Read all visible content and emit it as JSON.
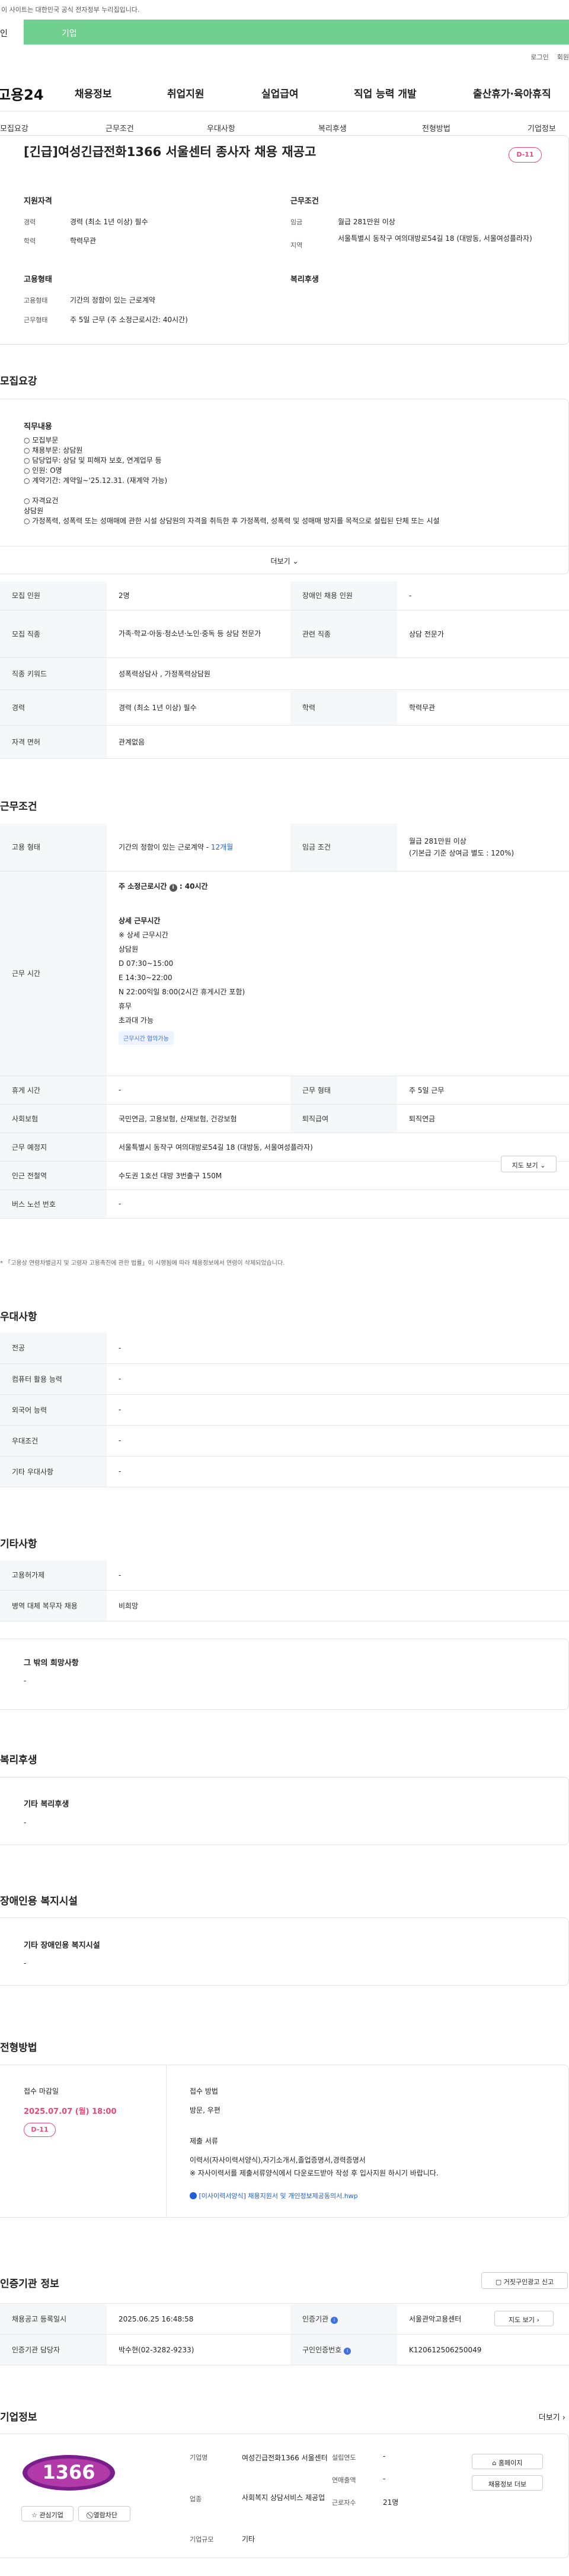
{
  "topbar": {
    "notice": "이 사이트는 대한민국 공식 전자정부 누리집입니다."
  },
  "tabs": [
    "인",
    "기업"
  ],
  "util": [
    "로그인",
    "회원"
  ],
  "gnb": {
    "logo": "고용24",
    "menus": [
      "채용정보",
      "취업지원",
      "실업급여",
      "직업 능력 개발",
      "출산휴가·육아휴직"
    ]
  },
  "subnav": [
    "모집요강",
    "근무조건",
    "우대사항",
    "복리후생",
    "전형방법",
    "기업정보"
  ],
  "job": {
    "title": "[긴급]여성긴급전화1366 서울센터 종사자 채용 재공고",
    "dday": "D-11"
  },
  "summary": {
    "apply_title": "지원자격",
    "cond_title": "근무조건",
    "emp_title": "고용형태",
    "welfare_title": "복리후생",
    "career_lbl": "경력",
    "career": "경력 (최소 1년 이상) 필수",
    "edu_lbl": "학력",
    "edu": "학력무관",
    "wage_lbl": "임금",
    "wage": "월급 281만원 이상",
    "area_lbl": "지역",
    "area": "서울특별시 동작구 여의대방로54길 18 (대방동, 서울여성플라자)",
    "type_lbl": "고용형태",
    "type": "기간의 정함이 있는 근로계약",
    "form_lbl": "근무형태",
    "form": "주 5일 근무 (주 소정근로시간: 40시간)"
  },
  "req": {
    "head": "모집요강",
    "duty_title": "직무내용",
    "duty": "○ 모집부문\n○ 채용부문: 상담원\n○ 담당업무: 상담 및 피해자 보호, 연계업무 등\n○ 인원: O명\n○ 계약기간: 계약일~'25.12.31. (재계약 가능)\n\n○ 자격요건\n상담원\n○ 가정폭력, 성폭력 또는 성매매에 관한 시설 상담원의 자격을 취득한 후 가정폭력, 성폭력 및 성매매 방지를 목적으로 설립된 단체 또는 시설",
    "more": "더보기",
    "rows": [
      [
        "모집 인원",
        "2명",
        "장애인 채용 인원",
        "-"
      ],
      [
        "모집 직종",
        "가족·학교·아동·청소년·노인·중독 등 상담 전문가",
        "관련 직종",
        "상담 전문가"
      ],
      [
        "직종 키워드",
        "성폭력상담사 , 가정폭력상담원",
        "",
        ""
      ],
      [
        "경력",
        "경력 (최소 1년 이상) 필수",
        "학력",
        "학력무관"
      ],
      [
        "자격 면허",
        "관계없음",
        "",
        ""
      ]
    ]
  },
  "cond": {
    "head": "근무조건",
    "type_lbl": "고용 형태",
    "type": "기간의 정함이 있는 근로계약 - ",
    "months": "12개월",
    "wage_lbl": "임금 조건",
    "wage": "월급 281만원 이상\n(기본급 기준 상여금 별도 : 120%)",
    "time_lbl": "근무 시간",
    "hours_label": "주 소정근로시간",
    "hours": "40시간",
    "detail_title": "상세 근무시간",
    "detail": "※ 상세 근무시간\n상담원\nD 07:30~15:00\nE 14:30~22:00\nN 22:00익일 8:00(2시간 휴게시간 포함)\n휴무\n초과대 가능",
    "tag": "근무시간 협의가능",
    "rest_lbl": "휴게 시간",
    "rest": "-",
    "form_lbl": "근무 형태",
    "form": "주 5일 근무",
    "ins_lbl": "사회보험",
    "ins": "국민연금, 고용보험, 산재보험, 건강보험",
    "ret_lbl": "퇴직급여",
    "ret": "퇴직연금",
    "loc_lbl": "근무 예정지",
    "loc": "서울특별시 동작구 여의대방로54길 18 (대방동, 서울여성플라자)",
    "map": "지도 보기",
    "sub_lbl": "인근 전철역",
    "sub": "수도권 1호선 대방 3번출구 150M",
    "bus_lbl": "버스 노선 번호",
    "bus": "-",
    "note": "* 「고용상 연령차별금지 및 고령자 고용촉진에 관한 법률」이 시행됨에 따라 채용정보에서 연령이 삭제되었습니다."
  },
  "pref": {
    "head": "우대사항",
    "rows": [
      [
        "전공",
        "-"
      ],
      [
        "컴퓨터 활용 능력",
        "-"
      ],
      [
        "외국어 능력",
        "-"
      ],
      [
        "우대조건",
        "-"
      ],
      [
        "기타 우대사항",
        "-"
      ]
    ]
  },
  "etc": {
    "head": "기타사항",
    "rows": [
      [
        "고용허가제",
        "-"
      ],
      [
        "병역 대체 복무자 채용",
        "비희망"
      ]
    ],
    "hope_title": "그 밖의 희망사항",
    "hope": "-"
  },
  "welfare": {
    "head": "복리후생",
    "title": "기타 복리후생",
    "val": "-"
  },
  "disabled": {
    "head": "장애인용 복지시설",
    "title": "기타 장애인용 복지시설",
    "val": "-"
  },
  "screen": {
    "head": "전형방법",
    "deadline_lbl": "접수 마감일",
    "deadline": "2025.07.07 (월) 18:00",
    "dday": "D-11",
    "method_lbl": "접수 방법",
    "method": "방문, 우편",
    "docs_lbl": "제출 서류",
    "docs": "이력서(자사이력서양식),자기소개서,졸업증명서,경력증명서\n※ 자사이력서를 제출서류양식에서 다운로드받아 작성 후 입사지원 하시기 바랍니다.",
    "file": "[이사이력서양식] 채용지원서 및 개인정보제공동의서.hwp"
  },
  "cert": {
    "head": "인증기관 정보",
    "btn": "거짓구인광고 신고",
    "rows": [
      [
        "채용공고 등록일시",
        "2025.06.25 16:48:58",
        "인증기관",
        "서울관악고용센터"
      ],
      [
        "인증기관 담당자",
        "박수현(02-3282-9233)",
        "구인인증번호",
        "K120612506250049"
      ]
    ],
    "map": "지도 보기"
  },
  "company": {
    "head": "기업정보",
    "more": "더보기",
    "logo": "1366",
    "fav": "관심기업",
    "block": "열람차단",
    "name_lbl": "기업명",
    "name": "여성긴급전화1366 서울센터",
    "year_lbl": "설립연도",
    "year": "-",
    "industry_lbl": "업종",
    "industry": "사회복지 상담서비스 제공업",
    "sales_lbl": "연매출액",
    "sales": "-",
    "emp_lbl": "근로자수",
    "emp": "21명",
    "size_lbl": "기업규모",
    "size": "기타",
    "home": "홈페이지",
    "jobs": "채용정보 더보"
  }
}
